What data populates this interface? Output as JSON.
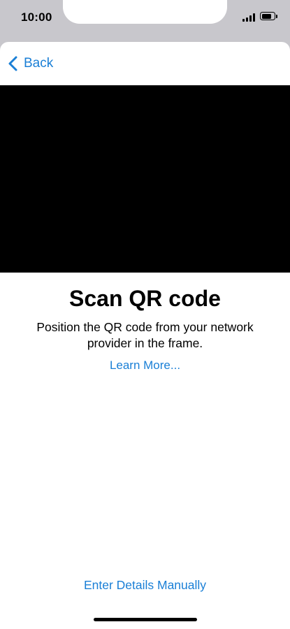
{
  "status_bar": {
    "time": "10:00",
    "battery_level": 0.85
  },
  "nav": {
    "back_label": "Back"
  },
  "main": {
    "title": "Scan QR code",
    "description": "Position the QR code from your network provider in the frame.",
    "learn_more_label": "Learn More..."
  },
  "footer": {
    "manual_entry_label": "Enter Details Manually"
  },
  "colors": {
    "accent": "#1a7fd6",
    "status_bar_bg": "#c8c7cc",
    "camera_bg": "#000000"
  },
  "icons": {
    "back": "chevron-left-icon",
    "signal": "cellular-signal-icon",
    "battery": "battery-icon"
  }
}
